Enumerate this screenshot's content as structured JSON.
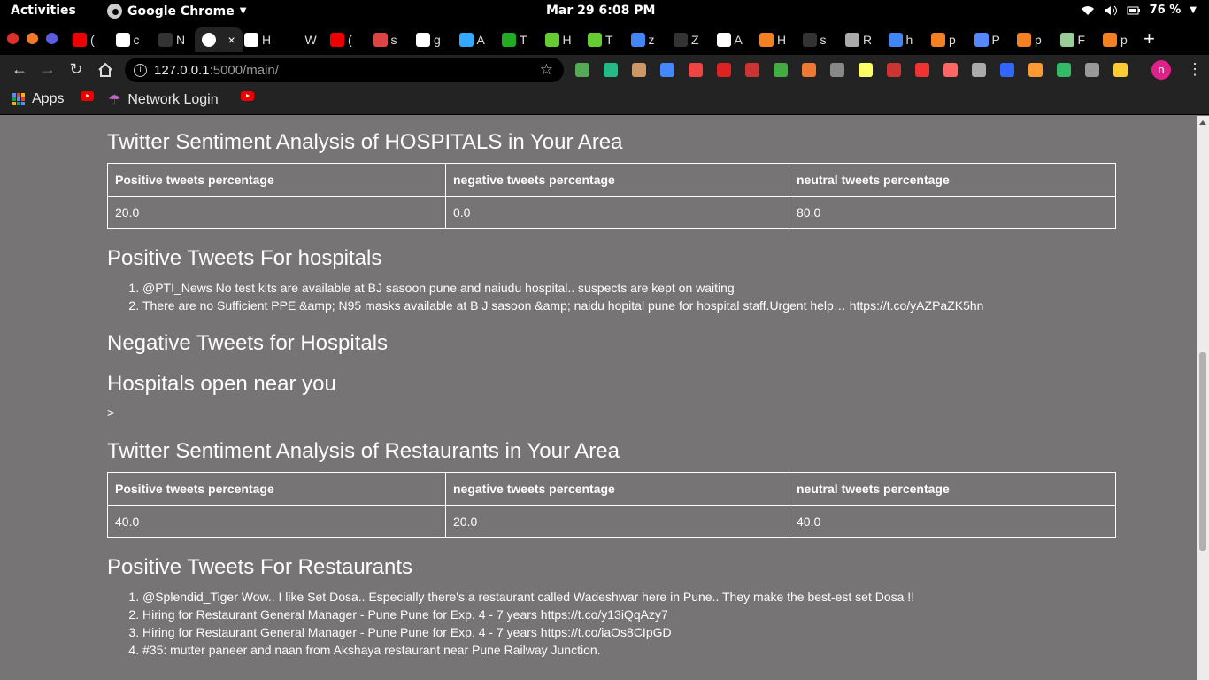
{
  "system": {
    "activities": "Activities",
    "app_name": "Google Chrome",
    "clock": "Mar 29   6:08 PM",
    "battery": "76 %"
  },
  "browser": {
    "tabs": [
      {
        "label": "(",
        "color": "#e00"
      },
      {
        "label": "c",
        "color": "#fff"
      },
      {
        "label": "N",
        "color": "#333"
      },
      {
        "label": "",
        "color": "#fff",
        "active": true
      },
      {
        "label": "H",
        "color": "#fff"
      },
      {
        "label": "W",
        "color": "#000"
      },
      {
        "label": "(",
        "color": "#e00"
      },
      {
        "label": "s",
        "color": "#d44"
      },
      {
        "label": "g",
        "color": "#fff"
      },
      {
        "label": "A",
        "color": "#3af"
      },
      {
        "label": "T",
        "color": "#2a2"
      },
      {
        "label": "H",
        "color": "#6c3"
      },
      {
        "label": "T",
        "color": "#6c3"
      },
      {
        "label": "z",
        "color": "#4285f4"
      },
      {
        "label": "Z",
        "color": "#333"
      },
      {
        "label": "A",
        "color": "#fff"
      },
      {
        "label": "H",
        "color": "#f48024"
      },
      {
        "label": "s",
        "color": "#333"
      },
      {
        "label": "R",
        "color": "#aaa"
      },
      {
        "label": "h",
        "color": "#4285f4"
      },
      {
        "label": "p",
        "color": "#f48024"
      },
      {
        "label": "P",
        "color": "#58f"
      },
      {
        "label": "p",
        "color": "#f48024"
      },
      {
        "label": "F",
        "color": "#9c9"
      },
      {
        "label": "p",
        "color": "#f48024"
      }
    ],
    "url_host": "127.0.0.1",
    "url_path": ":5000/main/",
    "profile_initial": "n",
    "bookmarks": {
      "apps": "Apps",
      "network_login": "Network Login"
    }
  },
  "page": {
    "hospitals": {
      "title": "Twitter Sentiment Analysis of HOSPITALS in Your Area",
      "headers": [
        "Positive tweets percentage",
        "negative tweets percentage",
        "neutral tweets percentage"
      ],
      "values": [
        "20.0",
        "0.0",
        "80.0"
      ],
      "positive_title": "Positive Tweets For hospitals",
      "positive_tweets": [
        "@PTI_News No test kits are available at BJ sasoon pune and naiudu hospital.. suspects are kept on waiting",
        "There are no Sufficient PPE &amp; N95 masks available at B J sasoon &amp; naidu hopital pune for hospital staff.Urgent help… https://t.co/yAZPaZK5hn"
      ],
      "negative_title": "Negative Tweets for Hospitals",
      "open_title": "Hospitals open near you",
      "open_text": ">"
    },
    "restaurants": {
      "title": "Twitter Sentiment Analysis of Restaurants in Your Area",
      "headers": [
        "Positive tweets percentage",
        "negative tweets percentage",
        "neutral tweets percentage"
      ],
      "values": [
        "40.0",
        "20.0",
        "40.0"
      ],
      "positive_title": "Positive Tweets For Restaurants",
      "positive_tweets": [
        "@Splendid_Tiger Wow.. I like Set Dosa.. Especially there's a restaurant called Wadeshwar here in Pune.. They make the best-est set Dosa !!",
        "Hiring for Restaurant General Manager - Pune Pune for Exp. 4 - 7 years https://t.co/y13iQqAzy7",
        "Hiring for Restaurant General Manager - Pune Pune for Exp. 4 - 7 years https://t.co/iaOs8CIpGD",
        "#35: mutter paneer and naan from Akshaya restaurant near Pune Railway Junction."
      ]
    }
  }
}
